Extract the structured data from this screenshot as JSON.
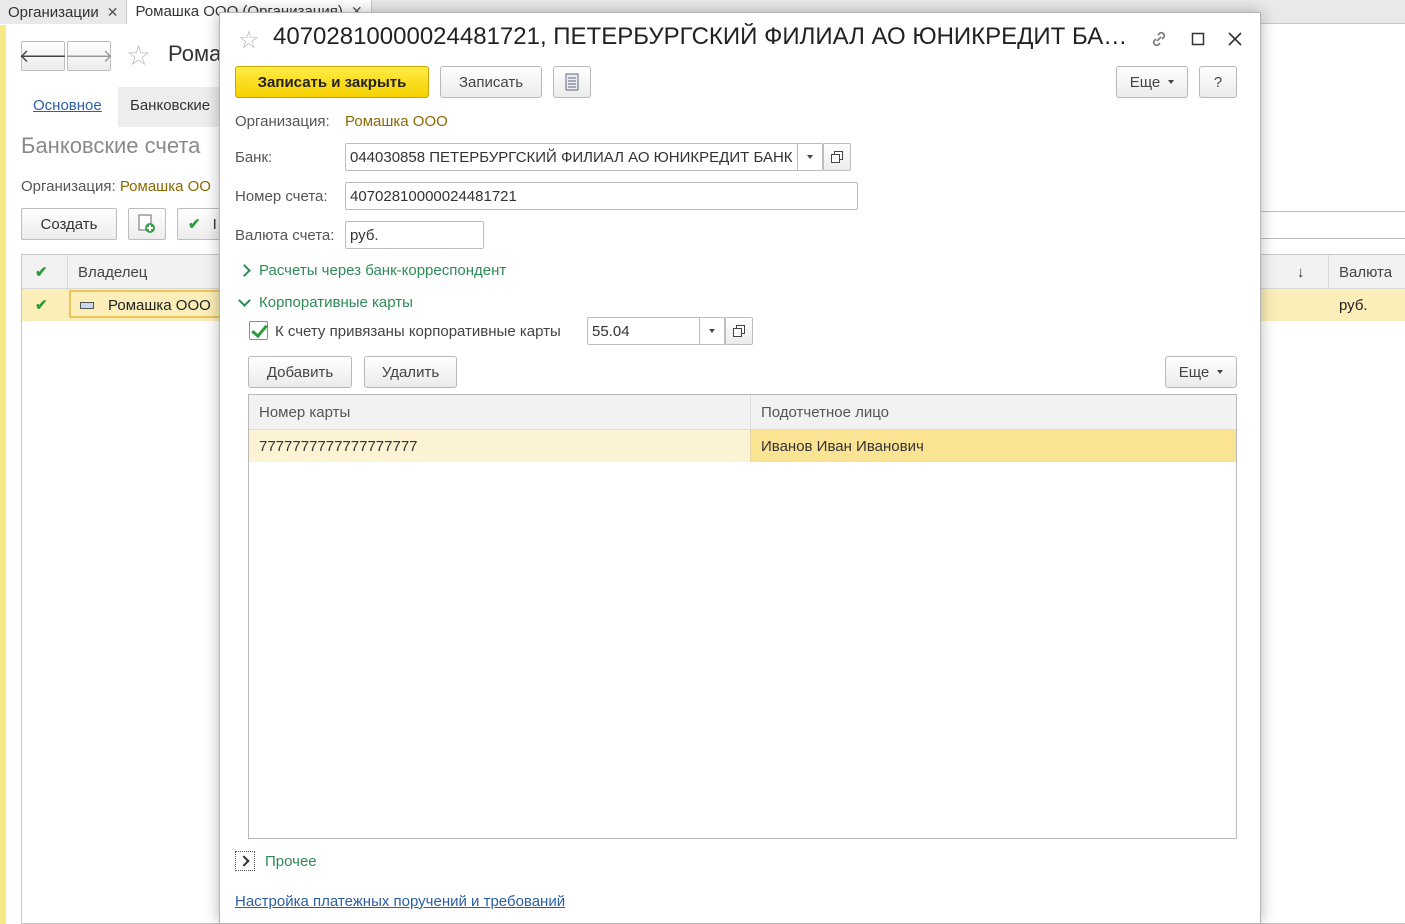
{
  "tabs": [
    {
      "label": "Организации"
    },
    {
      "label": "Ромашка ООО (Организация)"
    }
  ],
  "background": {
    "title": "Рома",
    "tab_link": "Основное",
    "tab_current": "Банковские",
    "section_title": "Банковские счета",
    "org_label": "Организация:",
    "org_value": "Ромашка ОО",
    "create_button": "Создать",
    "third_button_partial": "I",
    "grid": {
      "col_owner": "Владелец",
      "col_currency": "Валюта",
      "row_owner": "Ромашка ООО",
      "row_currency": "руб."
    }
  },
  "dialog": {
    "title": "40702810000024481721, ПЕТЕРБУРГСКИЙ ФИЛИАЛ АО ЮНИКРЕДИТ БАНК...",
    "toolbar": {
      "save_close": "Записать и закрыть",
      "save": "Записать",
      "more": "Еще",
      "help": "?"
    },
    "org_label": "Организация:",
    "org_value": "Ромашка ООО",
    "bank_label": "Банк:",
    "bank_value": "044030858 ПЕТЕРБУРГСКИЙ ФИЛИАЛ АО ЮНИКРЕДИТ БАНК",
    "account_label": "Номер счета:",
    "account_value": "40702810000024481721",
    "currency_label": "Валюта счета:",
    "currency_value": "руб.",
    "group_correspondent": "Расчеты через банк-корреспондент",
    "group_cards": "Корпоративные карты",
    "cards_checkbox_label": "К счету привязаны корпоративные карты",
    "cards_account_value": "55.04",
    "cards_add": "Добавить",
    "cards_delete": "Удалить",
    "cards_more": "Еще",
    "cards_table": {
      "headers": [
        "Номер карты",
        "Подотчетное лицо"
      ],
      "rows": [
        [
          "7777777777777777777",
          "Иванов Иван Иванович"
        ]
      ]
    },
    "group_other": "Прочее",
    "footer_link": "Настройка платежных поручений и требований"
  }
}
